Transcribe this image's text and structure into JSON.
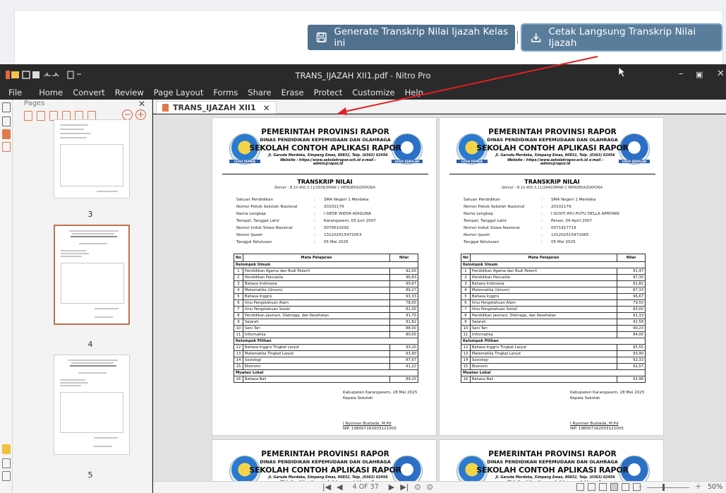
{
  "web": {
    "generate_label": "Generate Transkrip Nilai Ijazah Kelas ini",
    "separator": "|",
    "print_label": "Cetak Langsung Transkrip Nilai Ijazah"
  },
  "window": {
    "title": "TRANS_IJAZAH XII1.pdf - Nitro Pro",
    "controls": {
      "minimize": "–",
      "restore": "▣",
      "close": "✕"
    }
  },
  "menu": [
    "File",
    "Home",
    "Convert",
    "Review",
    "Page Layout",
    "Forms",
    "Share",
    "Erase",
    "Protect",
    "Customize",
    "Help"
  ],
  "panel": {
    "title": "Pages",
    "close": "✕",
    "thumb_labels": [
      "3",
      "4",
      "5"
    ]
  },
  "tab": {
    "label": "TRANS_IJAZAH XII1",
    "close": "✕"
  },
  "school": {
    "line1": "PEMERINTAH PROVINSI RAPOR",
    "line2": "DINAS PENDIDIKAN KEPEMUDAAN DAN OLAHRAGA",
    "line3": "SEKOLAH CONTOH APLIKASI RAPOR",
    "address": "Jl. Garuda Merdeka, Simpang Emas, 80832, Telp. (0363) 02456",
    "website": "Website : https://www.sekolahrapor.sch.id   e-mail : admin@rapor.id",
    "logo_left": "LOGO PEMDA",
    "logo_right": "LOGO SEKOLAH"
  },
  "doc_title": "TRANSKRIP NILAI",
  "ident_labels": [
    "Satuan Pendidikan",
    "Nomor Pokok Sekolah Nasional",
    "Nama Lengkap",
    "Tempat, Tanggal Lahir",
    "Nomor Induk Siswa Nasional",
    "Nomor Ijazah",
    "Tanggal Kelulusan"
  ],
  "table_headers": {
    "no": "No",
    "subject": "Mata Pelajaran",
    "grade": "Nilai"
  },
  "groups": {
    "umum": "Kelompok Umum",
    "pilihan": "Kelompok Pilihan",
    "lokal": "Muatan Lokal"
  },
  "subjects": [
    "Pendidikan Agama dan Budi Pekerti",
    "Pendidikan Pancasila",
    "Bahasa Indonesia",
    "Matematika (Umum)",
    "Bahasa Inggris",
    "Ilmu Pengetahuan Alam",
    "Ilmu Pengetahuan Sosial",
    "Pendidikan Jasmani, Olahraga, dan Kesehatan",
    "Sejarah",
    "Seni Tari",
    "Informatika",
    "Bahasa Inggris Tingkat Lanjut",
    "Matematika Tingkat Lanjut",
    "Sosiologi",
    "Ekonomi",
    "Bahasa Bali"
  ],
  "signature": {
    "place_date": "Kabupaten Karangasem, 28 Mei 2025",
    "role": "Kepala Sekolah",
    "name": "I Nyoman Budiada, M.Pd",
    "nip": "NIP. 198007162003121005"
  },
  "pages": [
    {
      "nomor": "Nomor : B.10.400.3.11/1839/SMAN 1 MERDEKA/DIKPORA",
      "ident_values": [
        "SMA Negeri 1 Merdeka",
        "20102179",
        "I GEDE WIDYA ADIGUNA",
        "Karangasem, 03 Juni 2007",
        "0079510292",
        "131202515472053",
        "05 Mei 2025"
      ],
      "grades": [
        "92,00",
        "96,83",
        "90,67",
        "89,27",
        "93,33",
        "78,00",
        "81,00",
        "91,70",
        "91,82",
        "88,00",
        "80,00",
        "93,20",
        "93,90",
        "87,67",
        "91,22",
        "89,25"
      ]
    },
    {
      "nomor": "Nomor : B.10.400.3.11/1840/SMAN 1 MERDEKA/DIKPORA",
      "ident_values": [
        "SMA Negeri 1 Merdeka",
        "20102179",
        "I GUSTI AYU PUTU DELLA APRIYANI",
        "Perasi, 04 April 2007",
        "0071917719",
        "131202515472065",
        "05 Mei 2025"
      ],
      "grades": [
        "91,47",
        "97,30",
        "91,82",
        "87,33",
        "96,67",
        "79,50",
        "83,00",
        "91,33",
        "92,58",
        "90,23",
        "84,00",
        "95,55",
        "93,90",
        "92,33",
        "92,57",
        "93,98"
      ]
    }
  ],
  "status": {
    "page_indicator": "4 OF 37",
    "zoom": "50%",
    "zoom_minus": "–",
    "zoom_plus": "+"
  },
  "colors": {
    "web_button": "#50718e",
    "accent": "#e07a4a",
    "arrow": "#e02020"
  }
}
